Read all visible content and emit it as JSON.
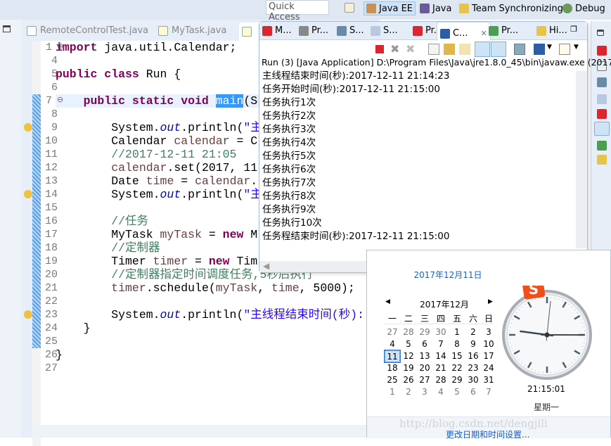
{
  "toolbar": {
    "quick_access": "Quick Access",
    "perspectives": [
      {
        "label": "Java EE",
        "active": true
      },
      {
        "label": "Java"
      },
      {
        "label": "Team Synchronizing"
      },
      {
        "label": "Debug"
      }
    ]
  },
  "editor": {
    "tabs": [
      "RemoteControlTest.java",
      "MyTask.java"
    ],
    "lines": [
      {
        "n": "1",
        "fold": "+",
        "toks": [
          [
            "import ",
            "kw"
          ],
          [
            "java.util.Calendar;",
            ""
          ]
        ]
      },
      {
        "n": "4",
        "toks": []
      },
      {
        "n": "5",
        "toks": [
          [
            "public class ",
            "kw"
          ],
          [
            "Run {",
            ""
          ]
        ]
      },
      {
        "n": "6",
        "toks": []
      },
      {
        "n": "7",
        "fold": "-",
        "toks": [
          [
            "    public static void ",
            "kw"
          ],
          [
            "main",
            "sel"
          ],
          [
            "(S",
            ""
          ]
        ]
      },
      {
        "n": "8",
        "toks": []
      },
      {
        "n": "9",
        "warn": true,
        "toks": [
          [
            "        System.",
            ""
          ],
          [
            "out",
            "it"
          ],
          [
            ".println(",
            ""
          ],
          [
            "\"主",
            "st"
          ]
        ]
      },
      {
        "n": "10",
        "toks": [
          [
            "        Calendar ",
            ""
          ],
          [
            "calendar",
            "vr"
          ],
          [
            " = C",
            ""
          ]
        ]
      },
      {
        "n": "11",
        "toks": [
          [
            "        //2017-12-11 21:05",
            "cm"
          ]
        ]
      },
      {
        "n": "12",
        "toks": [
          [
            "        ",
            ""
          ],
          [
            "calendar",
            "vr"
          ],
          [
            ".set(2017, 11",
            ""
          ]
        ]
      },
      {
        "n": "13",
        "toks": [
          [
            "        Date ",
            ""
          ],
          [
            "time",
            "vr"
          ],
          [
            " = ",
            ""
          ],
          [
            "calendar",
            "vr"
          ],
          [
            ".",
            ""
          ]
        ]
      },
      {
        "n": "14",
        "warn": true,
        "toks": [
          [
            "        System.",
            ""
          ],
          [
            "out",
            "it"
          ],
          [
            ".println(",
            ""
          ],
          [
            "\"主",
            "st"
          ]
        ]
      },
      {
        "n": "15",
        "toks": []
      },
      {
        "n": "16",
        "toks": [
          [
            "        //任务",
            "cm"
          ]
        ]
      },
      {
        "n": "17",
        "toks": [
          [
            "        MyTask ",
            ""
          ],
          [
            "myTask",
            "vr"
          ],
          [
            " = ",
            ""
          ],
          [
            "new ",
            "kw"
          ],
          [
            "M",
            ""
          ]
        ]
      },
      {
        "n": "18",
        "toks": [
          [
            "        //定制器",
            "cm"
          ]
        ]
      },
      {
        "n": "19",
        "toks": [
          [
            "        Timer ",
            ""
          ],
          [
            "timer",
            "vr"
          ],
          [
            " = ",
            ""
          ],
          [
            "new ",
            "kw"
          ],
          [
            "Tim",
            ""
          ]
        ]
      },
      {
        "n": "20",
        "toks": [
          [
            "        //定制器指定时间调度任务,5秒后执行",
            "cm"
          ]
        ]
      },
      {
        "n": "21",
        "toks": [
          [
            "        ",
            ""
          ],
          [
            "timer",
            "vr"
          ],
          [
            ".schedule(",
            ""
          ],
          [
            "myTask",
            "vr"
          ],
          [
            ", ",
            ""
          ],
          [
            "time",
            "vr"
          ],
          [
            ", 5000);",
            ""
          ]
        ]
      },
      {
        "n": "22",
        "toks": []
      },
      {
        "n": "23",
        "warn": true,
        "toks": [
          [
            "        System.",
            ""
          ],
          [
            "out",
            "it"
          ],
          [
            ".println(",
            ""
          ],
          [
            "\"主线程结束时间(秒): \"",
            "st"
          ],
          [
            " +",
            ""
          ]
        ]
      },
      {
        "n": "24",
        "toks": [
          [
            "    }",
            ""
          ]
        ]
      },
      {
        "n": "25",
        "toks": []
      },
      {
        "n": "26",
        "toks": [
          [
            "}",
            ""
          ]
        ]
      },
      {
        "n": "27",
        "toks": []
      }
    ]
  },
  "console": {
    "tabs": [
      "M...",
      "Pr...",
      "S...",
      "S...",
      "Pr...",
      "C...",
      "Pr...",
      "Hi..."
    ],
    "active_tab": 5,
    "run_line": "Run (3) [Java Application] D:\\Program Files\\Java\\jre1.8.0_45\\bin\\javaw.exe (2017-",
    "output": [
      "主线程结束时间(秒):2017-12-11 21:14:23",
      "任务开始时间(秒):2017-12-11 21:15:00",
      "任务执行1次",
      "任务执行2次",
      "任务执行3次",
      "任务执行4次",
      "任务执行5次",
      "任务执行6次",
      "任务执行7次",
      "任务执行8次",
      "任务执行9次",
      "任务执行10次",
      "任务程结束时间(秒):2017-12-11 21:15:00"
    ]
  },
  "calendar": {
    "date_header": "2017年12月11日",
    "month": "2017年12月",
    "weekdays": [
      "一",
      "二",
      "三",
      "四",
      "五",
      "六",
      "日"
    ],
    "days": [
      "27",
      "28",
      "29",
      "30",
      "1",
      "2",
      "3",
      "4",
      "5",
      "6",
      "7",
      "8",
      "9",
      "10",
      "11",
      "12",
      "13",
      "14",
      "15",
      "16",
      "17",
      "18",
      "19",
      "20",
      "21",
      "22",
      "23",
      "24",
      "25",
      "26",
      "27",
      "28",
      "29",
      "30",
      "31",
      "1",
      "2",
      "3",
      "4",
      "5",
      "6",
      "7"
    ],
    "today_index": 14,
    "time": "21:15:01",
    "weekday": "星期一",
    "change_link": "更改日期和时间设置...",
    "clock": {
      "hour": 21,
      "minute": 15,
      "second": 1
    },
    "accent": "#1a5fc7"
  },
  "watermark": "http://blog.csdn.net/dengjili"
}
